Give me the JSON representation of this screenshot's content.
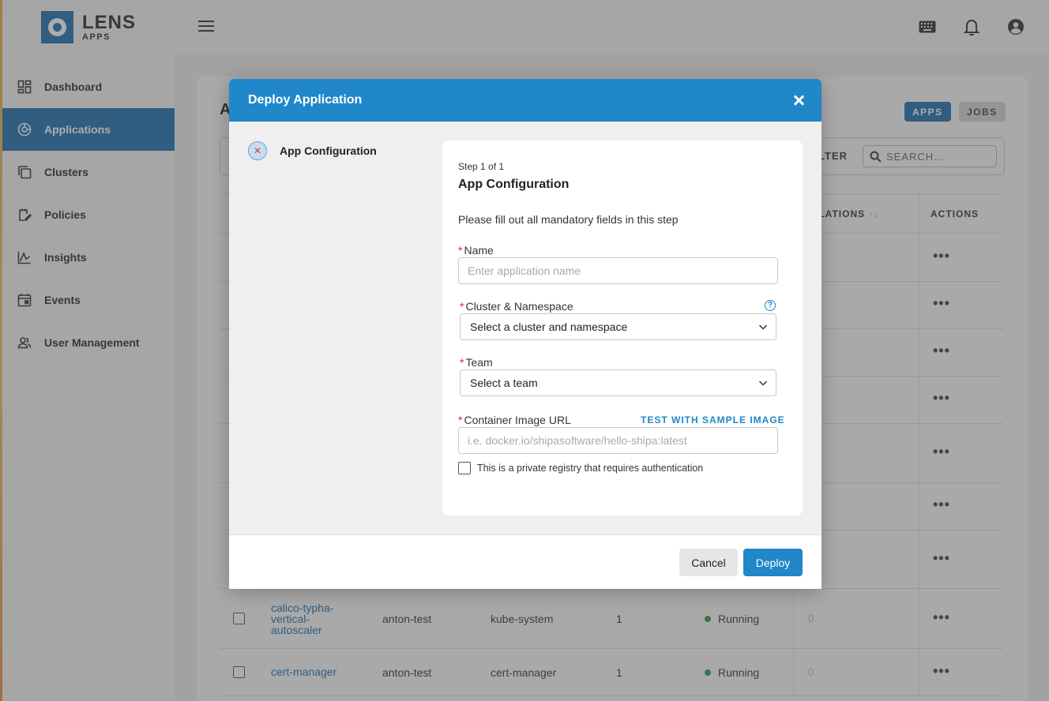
{
  "brand": {
    "name": "LENS",
    "sub": "APPS"
  },
  "sidebar": {
    "items": [
      {
        "label": "Dashboard",
        "icon": "dashboard-icon"
      },
      {
        "label": "Applications",
        "icon": "applications-icon",
        "active": true
      },
      {
        "label": "Clusters",
        "icon": "clusters-icon"
      },
      {
        "label": "Policies",
        "icon": "policies-icon"
      },
      {
        "label": "Insights",
        "icon": "insights-icon"
      },
      {
        "label": "Events",
        "icon": "events-icon"
      },
      {
        "label": "User Management",
        "icon": "users-icon"
      }
    ]
  },
  "topbar": {
    "icons": [
      "menu-icon",
      "keyboard-icon",
      "bell-icon",
      "account-icon"
    ]
  },
  "page": {
    "heading": "A",
    "tabs": {
      "apps": "APPS",
      "jobs": "JOBS"
    },
    "filter_label": "LTER",
    "search_placeholder": "SEARCH..."
  },
  "table": {
    "headers": {
      "violations": "OLATIONS",
      "actions": "ACTIONS"
    },
    "row_zero": "0",
    "actions_glyph": "•••",
    "rows": [
      {
        "name": "calico-typha-vertical-autoscaler",
        "cluster": "anton-test",
        "namespace": "kube-system",
        "count": "1",
        "status": "Running",
        "violations": "0"
      },
      {
        "name": "cert-manager",
        "cluster": "anton-test",
        "namespace": "cert-manager",
        "count": "1",
        "status": "Running",
        "violations": "0"
      }
    ]
  },
  "colors": {
    "accent": "#2087c8",
    "nav_active": "#1f6fb0",
    "required": "#d6222a",
    "status_running": "#2e9d48"
  },
  "modal": {
    "title": "Deploy Application",
    "step_nav": {
      "label": "App Configuration",
      "status_icon": "error-x-icon"
    },
    "form": {
      "step_counter": "Step 1 of 1",
      "title": "App Configuration",
      "description": "Please fill out all mandatory fields in this step",
      "required_mark": "*",
      "name": {
        "label": "Name",
        "placeholder": "Enter application name",
        "value": ""
      },
      "cluster": {
        "label": "Cluster & Namespace",
        "value": "Select a cluster and namespace",
        "help": "?"
      },
      "team": {
        "label": "Team",
        "value": "Select a team"
      },
      "image": {
        "label": "Container Image URL",
        "placeholder": "i.e. docker.io/shipasoftware/hello-shipa:latest",
        "value": "",
        "sample_link": "TEST WITH SAMPLE IMAGE"
      },
      "private_registry": {
        "label": "This is a private registry that requires authentication",
        "checked": false
      }
    },
    "footer": {
      "cancel": "Cancel",
      "deploy": "Deploy"
    }
  }
}
